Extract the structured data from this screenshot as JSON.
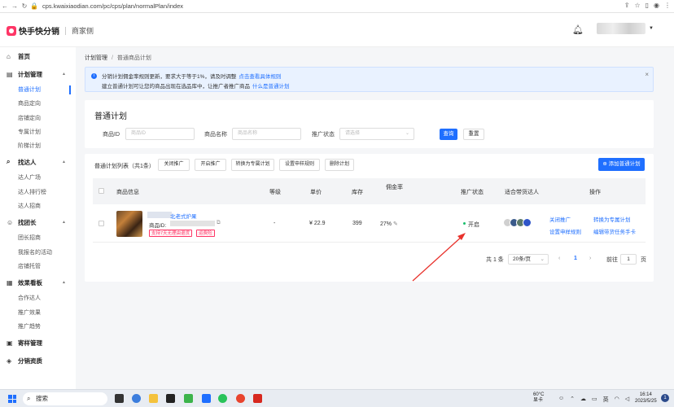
{
  "browser": {
    "url": "cps.kwaixiaodian.com/pc/cps/plan/normalPlan/index"
  },
  "header": {
    "logo_text": "快手快分销",
    "subtitle": "商家侧"
  },
  "sidebar": {
    "groups": [
      {
        "label": "首页",
        "items": []
      },
      {
        "label": "计划管理",
        "items": [
          "普通计划",
          "商品定向",
          "店铺定向",
          "专属计划",
          "阶梯计划"
        ]
      },
      {
        "label": "找达人",
        "items": [
          "达人广场",
          "达人排行榜",
          "达人招商"
        ]
      },
      {
        "label": "找团长",
        "items": [
          "团长招商",
          "我报名的活动",
          "店铺托管"
        ]
      },
      {
        "label": "效果看板",
        "items": [
          "合作达人",
          "推广效果",
          "推广趋势"
        ]
      },
      {
        "label": "寄样管理",
        "items": []
      },
      {
        "label": "分销资质",
        "items": []
      }
    ]
  },
  "breadcrumb": {
    "root": "计划管理",
    "sep": "/",
    "current": "普通商品计划"
  },
  "notice": {
    "line1": "分销计划佣金率规则更新，要求大于等于1%，请及时调整",
    "line1_link": "点击查看具体规则",
    "line2": "建立普通计划可让您的商品出现在选品库中，让推广者推广商品",
    "line2_link": "什么是普通计划",
    "close": "×"
  },
  "search": {
    "title": "普通计划",
    "product_id_label": "商品ID",
    "product_id_placeholder": "商品ID",
    "product_name_label": "商品名称",
    "product_name_placeholder": "商品名称",
    "status_label": "推广状态",
    "status_placeholder": "请选择",
    "query_button": "查询",
    "reset_button": "重置"
  },
  "list": {
    "title": "普通计划列表（共1条）",
    "toolbar": [
      "关闭推广",
      "开启推广",
      "转换为专属计划",
      "设置申样规则",
      "删除计划"
    ],
    "add_button": "添加普通计划",
    "columns": [
      "商品信息",
      "等级",
      "单价",
      "库存",
      "佣金率",
      "推广状态",
      "适合带货达人",
      "操作"
    ],
    "rows": [
      {
        "name": "北老式炉果",
        "id_label": "商品ID:",
        "tags": [
          "支持7天无理由退货",
          "运费险"
        ],
        "level": "-",
        "price": "¥ 22.9",
        "stock": "399",
        "commission": "27%",
        "status": "开启",
        "actions": [
          "关闭推广",
          "转换为专属计划",
          "设置申样规则",
          "编辑带货任务手卡"
        ]
      }
    ]
  },
  "pagination": {
    "total": "共 1 条",
    "page_size": "20条/页",
    "prev": "‹",
    "current_page": "1",
    "next": "›",
    "goto_label": "前往",
    "goto_value": "1",
    "page_unit": "页"
  },
  "taskbar": {
    "search_label": "搜索",
    "weather_temp": "60°C",
    "weather_label": "显卡",
    "ime": "英",
    "time": "16:14",
    "date": "2023/5/25",
    "notif_count": "1"
  }
}
